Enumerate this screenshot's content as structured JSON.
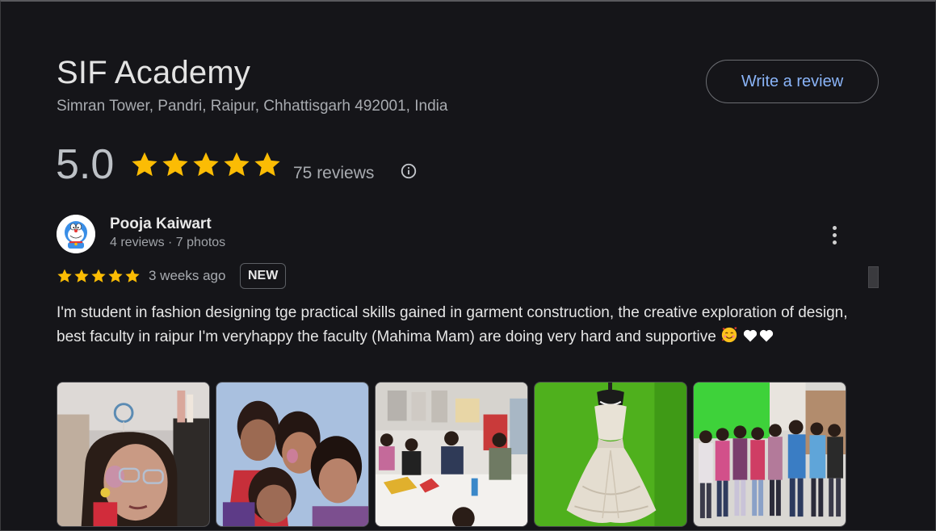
{
  "business": {
    "name": "SIF Academy",
    "address": "Simran Tower, Pandri, Raipur, Chhattisgarh 492001, India"
  },
  "actions": {
    "write_review_label": "Write a review"
  },
  "summary": {
    "rating": "5.0",
    "stars": 5,
    "reviews_label": "75 reviews"
  },
  "review": {
    "author": "Pooja Kaiwart",
    "author_meta": "4 reviews · 7 photos",
    "stars": 5,
    "time": "3 weeks ago",
    "badge": "NEW",
    "text_main": "I'm student in fashion designing tge practical skills gained in garment construction, the creative exploration of design, best faculty in raipur I'm veryhappy the faculty (Mahima Mam) are doing very hard and supportive ",
    "photos": [
      {
        "icon": "photo-selfie-girl"
      },
      {
        "icon": "photo-group-selfie"
      },
      {
        "icon": "photo-classroom"
      },
      {
        "icon": "photo-white-gown"
      },
      {
        "icon": "photo-group-students"
      }
    ]
  },
  "colors": {
    "background": "#151519",
    "star": "#fbbc04",
    "link": "#8ab4f8"
  }
}
